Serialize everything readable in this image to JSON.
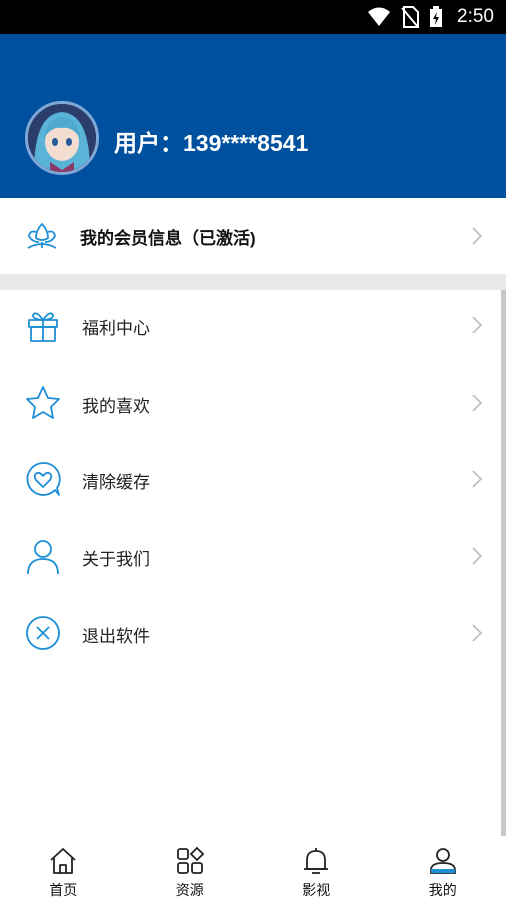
{
  "status_bar": {
    "time": "2:50",
    "icons": [
      "wifi-icon",
      "no-sim-icon",
      "battery-charging-icon"
    ]
  },
  "header": {
    "user_label": "用户：139****8541",
    "accent_color": "#0050a0"
  },
  "member": {
    "label": "我的会员信息（已激活)",
    "icon": "lotus-icon"
  },
  "menu": {
    "items": [
      {
        "label": "福利中心",
        "icon": "gift-icon"
      },
      {
        "label": "我的喜欢",
        "icon": "star-icon"
      },
      {
        "label": "清除缓存",
        "icon": "heart-bubble-icon"
      },
      {
        "label": "关于我们",
        "icon": "person-icon"
      },
      {
        "label": "退出软件",
        "icon": "close-circle-icon"
      }
    ]
  },
  "tabbar": {
    "tabs": [
      {
        "label": "首页",
        "icon": "home-icon",
        "active": false
      },
      {
        "label": "资源",
        "icon": "grid-icon",
        "active": false
      },
      {
        "label": "影视",
        "icon": "bell-icon",
        "active": false
      },
      {
        "label": "我的",
        "icon": "user-icon",
        "active": true
      }
    ]
  },
  "colors": {
    "icon_blue": "#1e8fd6",
    "chevron": "#bbbbbb"
  }
}
